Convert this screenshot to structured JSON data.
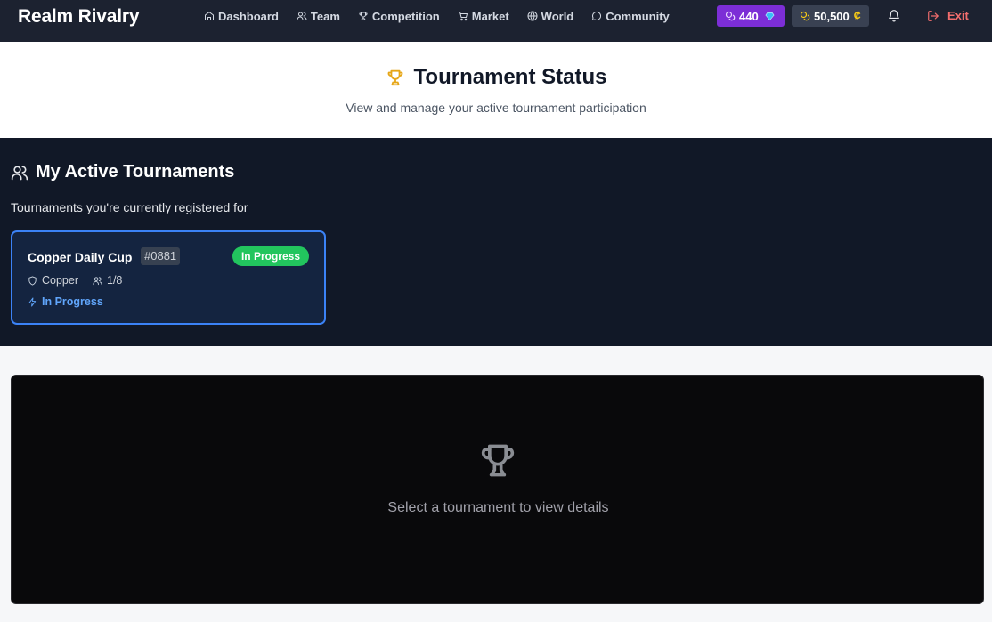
{
  "app": {
    "title": "Realm Rivalry"
  },
  "nav": {
    "items": [
      {
        "label": "Dashboard",
        "icon": "home-icon"
      },
      {
        "label": "Team",
        "icon": "users-icon"
      },
      {
        "label": "Competition",
        "icon": "trophy-icon"
      },
      {
        "label": "Market",
        "icon": "cart-icon"
      },
      {
        "label": "World",
        "icon": "globe-icon"
      },
      {
        "label": "Community",
        "icon": "chat-icon"
      }
    ]
  },
  "currency": {
    "gems": {
      "amount": "440",
      "icon": "gem-icon",
      "color": "#7c2ed6"
    },
    "gold": {
      "amount": "50,500",
      "suffix": "₡",
      "color": "#394152"
    }
  },
  "header_actions": {
    "exit_label": "Exit"
  },
  "page": {
    "title": "Tournament Status",
    "subtitle": "View and manage your active tournament participation"
  },
  "active_tournaments": {
    "title": "My Active Tournaments",
    "subtitle": "Tournaments you're currently registered for",
    "cards": [
      {
        "name": "Copper Daily Cup",
        "id": "#0881",
        "status_badge": "In Progress",
        "division": "Copper",
        "participants": "1/8",
        "progress_label": "In Progress",
        "selected": true
      }
    ]
  },
  "details": {
    "empty_message": "Select a tournament to view details"
  },
  "colors": {
    "topbar": "#1c2230",
    "section_bg": "#111827",
    "card_border": "#3b82f6",
    "badge_green": "#22c55e",
    "accent_gold": "#e6a617",
    "exit_red": "#f26d6d"
  }
}
